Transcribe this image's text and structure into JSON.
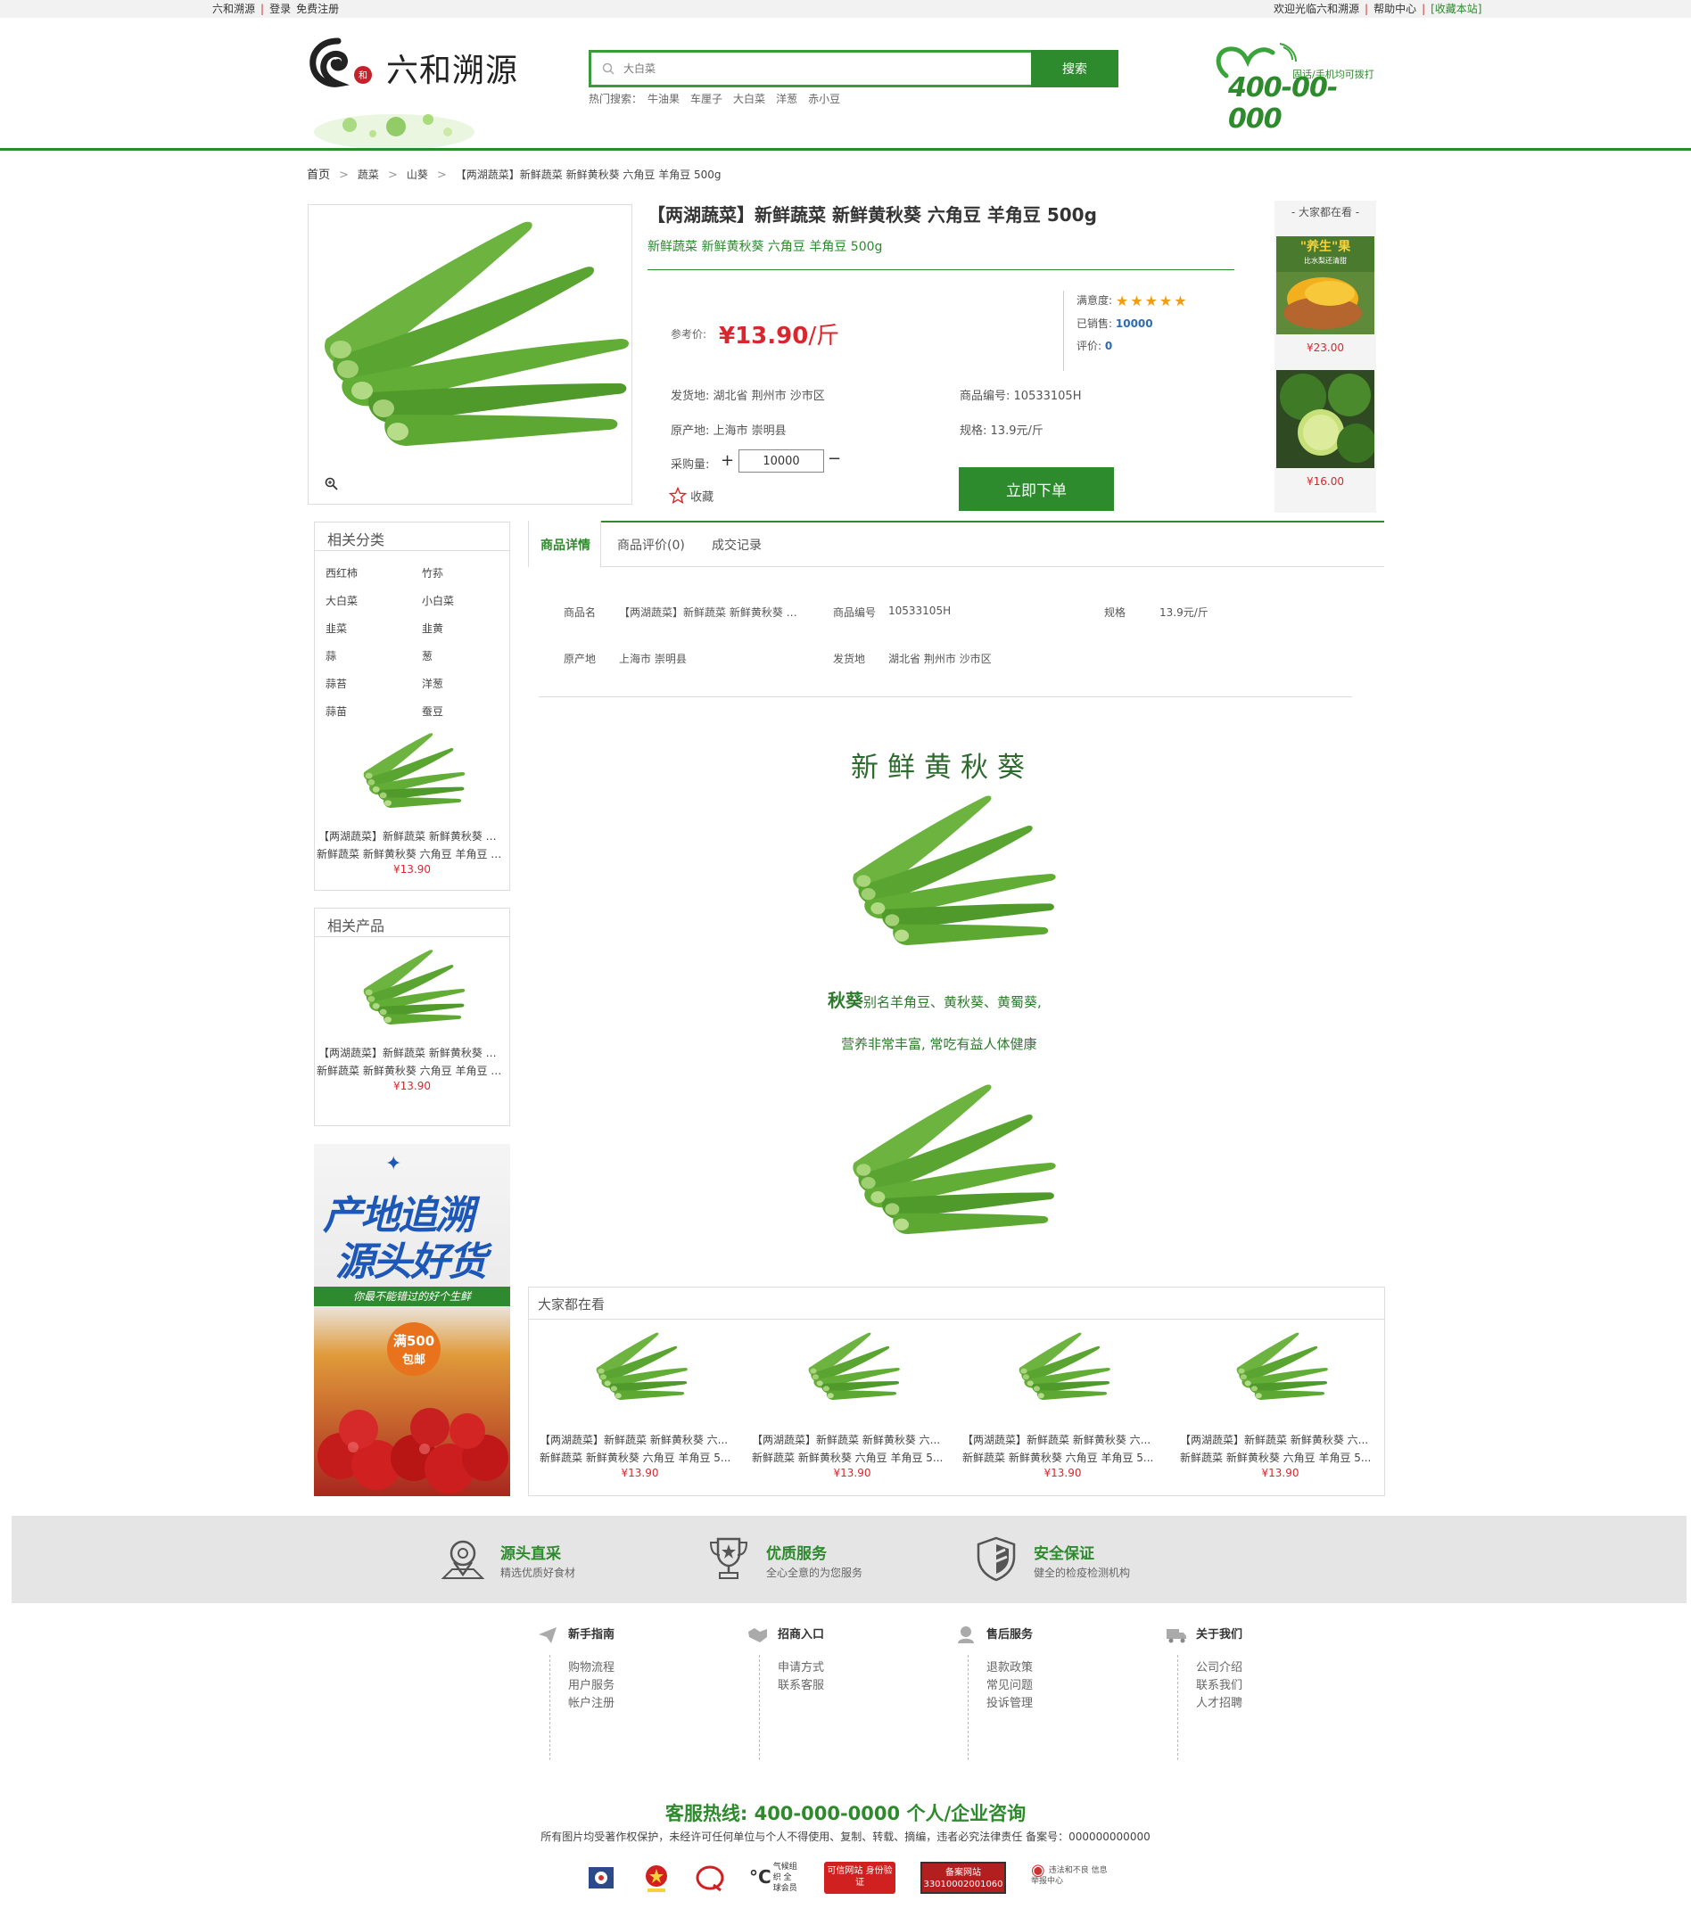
{
  "topbar": {
    "site": "六和溯源",
    "login": "登录",
    "register": "免费注册",
    "welcome": "欢迎光临六和溯源",
    "help": "帮助中心",
    "bookmark": "[收藏本站]"
  },
  "header": {
    "logo_text": "六和溯源",
    "search_placeholder": "大白菜",
    "search_button": "搜索",
    "hot_label": "热门搜索：",
    "hot_terms": [
      "牛油果",
      "车厘子",
      "大白菜",
      "洋葱",
      "赤小豆"
    ],
    "hotline_caption": "固话/手机均可拨打",
    "hotline_number": "400-00-000"
  },
  "breadcrumb": [
    "首页",
    "蔬菜",
    "山葵",
    "【两湖蔬菜】新鲜蔬菜 新鲜黄秋葵 六角豆 羊角豆 500g"
  ],
  "product": {
    "title": "【两湖蔬菜】新鲜蔬菜 新鲜黄秋葵 六角豆 羊角豆 500g",
    "subtitle": "新鲜蔬菜 新鲜黄秋葵 六角豆 羊角豆 500g",
    "price_label": "参考价:",
    "price": "¥13.90",
    "price_unit": "/斤",
    "rating_label": "满意度:",
    "rating_stars": 5,
    "sold_label": "已销售:",
    "sold": "10000",
    "reviews_label": "评价:",
    "reviews": "0",
    "ship_from_label": "发货地:",
    "ship_from": "湖北省 荆州市 沙市区",
    "code_label": "商品编号:",
    "code": "10533105H",
    "origin_label": "原产地:",
    "origin": "上海市 崇明县",
    "spec_label": "规格:",
    "spec": "13.9元/斤",
    "qty_label": "采购量:",
    "qty_plus": "+",
    "qty": "10000",
    "qty_minus": "−",
    "favorite": "收藏",
    "order_button": "立即下单",
    "colors": {
      "accent": "#2d8a2d",
      "price": "#d9272e"
    }
  },
  "side_viewing": {
    "title": "- 大家都在看 -",
    "items": [
      {
        "price": "¥23.00",
        "promo": "\"养生\"果",
        "promo_sub": "比水梨还清甜"
      },
      {
        "price": "¥16.00"
      }
    ]
  },
  "tabs": [
    "商品详情",
    "商品评价(0)",
    "成交记录"
  ],
  "specs": {
    "name_label": "商品名",
    "name": "【两湖蔬菜】新鲜蔬菜 新鲜黄秋葵 六...",
    "code_label": "商品编号",
    "code": "10533105H",
    "spec_label": "规格",
    "spec": "13.9元/斤",
    "origin_label": "原产地",
    "origin": "上海市 崇明县",
    "ship_label": "发货地",
    "ship": "湖北省 荆州市 沙市区"
  },
  "detail": {
    "heading": "新鲜黄秋葵",
    "line1_strong": "秋葵",
    "line1_rest": "别名羊角豆、黄秋葵、黄蜀葵,",
    "line2": "营养非常丰富, 常吃有益人体健康"
  },
  "left": {
    "categories_title": "相关分类",
    "categories": [
      "西红柿",
      "竹荪",
      "大白菜",
      "小白菜",
      "韭菜",
      "韭黄",
      "蒜",
      "葱",
      "蒜苔",
      "洋葱",
      "蒜苗",
      "蚕豆"
    ],
    "products_title": "相关产品",
    "product_line1": "【两湖蔬菜】新鲜蔬菜 新鲜黄秋葵 六...",
    "product_line2": "新鲜蔬菜 新鲜黄秋葵 六角豆 羊角豆 5...",
    "product_price": "¥13.90",
    "banner_line1": "产地追溯",
    "banner_line2": "源头好货",
    "banner_tag": "你最不能错过的好个生鲜",
    "banner_badge_1": "满500",
    "banner_badge_2": "包邮"
  },
  "everyone": {
    "title": "大家都在看",
    "items": [
      {
        "line1": "【两湖蔬菜】新鲜蔬菜 新鲜黄秋葵 六...",
        "line2": "新鲜蔬菜 新鲜黄秋葵 六角豆 羊角豆 5...",
        "price": "¥13.90"
      },
      {
        "line1": "【两湖蔬菜】新鲜蔬菜 新鲜黄秋葵 六...",
        "line2": "新鲜蔬菜 新鲜黄秋葵 六角豆 羊角豆 5...",
        "price": "¥13.90"
      },
      {
        "line1": "【两湖蔬菜】新鲜蔬菜 新鲜黄秋葵 六...",
        "line2": "新鲜蔬菜 新鲜黄秋葵 六角豆 羊角豆 5...",
        "price": "¥13.90"
      },
      {
        "line1": "【两湖蔬菜】新鲜蔬菜 新鲜黄秋葵 六...",
        "line2": "新鲜蔬菜 新鲜黄秋葵 六角豆 羊角豆 5...",
        "price": "¥13.90"
      }
    ]
  },
  "features": [
    {
      "title": "源头直采",
      "sub": "精选优质好食材",
      "icon": "location-icon"
    },
    {
      "title": "优质服务",
      "sub": "全心全意的为您服务",
      "icon": "trophy-icon"
    },
    {
      "title": "安全保证",
      "sub": "健全的检疫检测机构",
      "icon": "shield-icon"
    }
  ],
  "footer_cols": [
    {
      "title": "新手指南",
      "icon": "paper-plane-icon",
      "links": [
        "购物流程",
        "用户服务",
        "帐户注册"
      ]
    },
    {
      "title": "招商入口",
      "icon": "handshake-icon",
      "links": [
        "申请方式",
        "联系客服"
      ]
    },
    {
      "title": "售后服务",
      "icon": "customer-service-icon",
      "links": [
        "退款政策",
        "常见问题",
        "投诉管理"
      ]
    },
    {
      "title": "关于我们",
      "icon": "truck-icon",
      "links": [
        "公司介绍",
        "联系我们",
        "人才招聘"
      ]
    }
  ],
  "footer": {
    "hotline": "客服热线: 400-000-0000 个人/企业咨询",
    "copyright": "所有图片均受著作权保护，未经许可任何单位与个人不得使用、复制、转载、摘编，违者必究法律责任 备案号：000000000000",
    "badge_texts": [
      "气候组织 全球会员",
      "可信网站 身份验证",
      "备案网站 33010002001060",
      "违法和不良 信息举报中心"
    ]
  }
}
